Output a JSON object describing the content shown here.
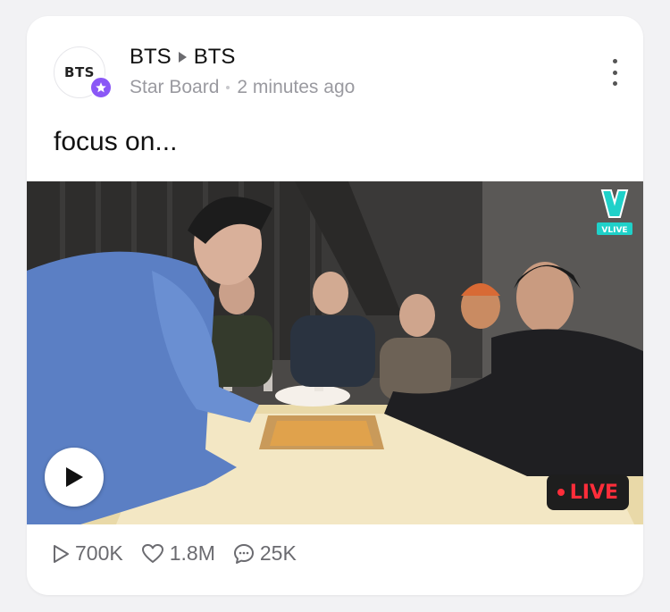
{
  "post": {
    "avatar_text": "BTS",
    "channel": "BTS",
    "board_channel": "BTS",
    "board": "Star Board",
    "time": "2 minutes ago",
    "text": "focus on..."
  },
  "video": {
    "provider_label": "VLIVE",
    "live_label": "LIVE"
  },
  "stats": {
    "plays": "700K",
    "likes": "1.8M",
    "comments": "25K"
  },
  "colors": {
    "accent_purple": "#8a57f6",
    "live_red": "#ff2d3a",
    "vlive_teal": "#1fd1c9"
  },
  "icons": [
    "star-icon",
    "more-vertical-icon",
    "vlive-logo-icon",
    "play-icon",
    "play-outline-icon",
    "heart-icon",
    "comment-icon"
  ]
}
